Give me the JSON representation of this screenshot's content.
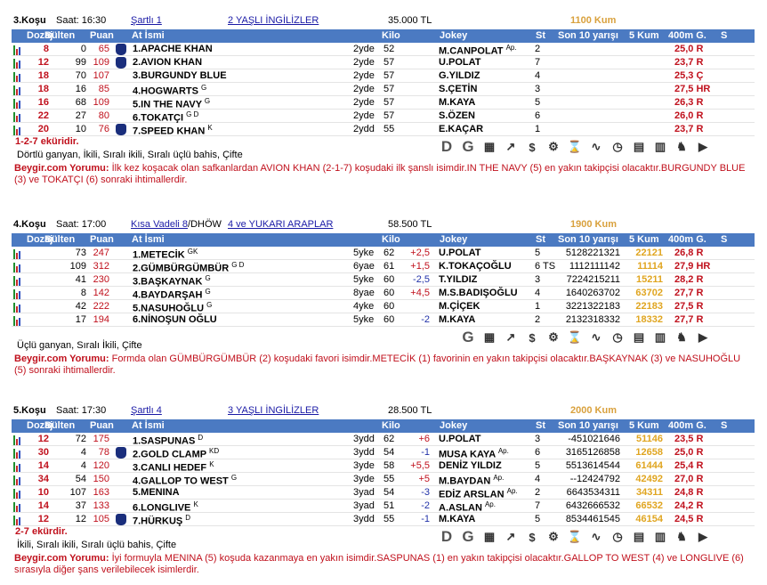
{
  "races": [
    {
      "kosu": "3.Koşu",
      "saat": "Saat: 16:30",
      "kosul": "Şartlı 1",
      "kosul2": "",
      "grup": "2 YAŞLI İNGİLİZLER",
      "ikramiye": "35.000 TL",
      "mesafe": "1100 Kum",
      "winners": "1-2-7 eküridir.",
      "bets": "Dörtlü ganyan, İkili, Sıralı ikili, Sıralı üçlü bahis, Çifte",
      "comment_label": "Beygir.com Yorumu:",
      "comment": "İlk kez koşacak olan safkanlardan AVION KHAN (2-1-7) koşudaki ilk şanslı isimdir.IN THE NAVY (5) en yakın takipçisi olacaktır.BURGUNDY BLUE (3) ve TOKATÇI (6) sonraki ihtimallerdir.",
      "toolbar": "full",
      "rows": [
        {
          "dozaj": "8",
          "bulten": "0",
          "puan": "65",
          "jokey_silk": true,
          "name": "1.APACHE KHAN",
          "sup": "",
          "age": "2yde",
          "kilo": "52",
          "plus": "",
          "jockey": "M.CANPOLAT",
          "jsup": "Ap.",
          "st": "2",
          "son": "",
          "k5": "",
          "g400": "25,0 R"
        },
        {
          "dozaj": "12",
          "bulten": "99",
          "puan": "109",
          "jokey_silk": true,
          "name": "2.AVION KHAN",
          "sup": "",
          "age": "2yde",
          "kilo": "57",
          "plus": "",
          "jockey": "U.POLAT",
          "jsup": "",
          "st": "7",
          "son": "",
          "k5": "",
          "g400": "23,7 R"
        },
        {
          "dozaj": "18",
          "bulten": "70",
          "puan": "107",
          "jokey_silk": false,
          "name": "3.BURGUNDY BLUE",
          "sup": "",
          "age": "2yde",
          "kilo": "57",
          "plus": "",
          "jockey": "G.YILDIZ",
          "jsup": "",
          "st": "4",
          "son": "",
          "k5": "",
          "g400": "25,3 Ç"
        },
        {
          "dozaj": "18",
          "bulten": "16",
          "puan": "85",
          "jokey_silk": false,
          "name": "4.HOGWARTS",
          "sup": "G",
          "age": "2yde",
          "kilo": "57",
          "plus": "",
          "jockey": "S.ÇETİN",
          "jsup": "",
          "st": "3",
          "son": "",
          "k5": "",
          "g400": "27,5 HR"
        },
        {
          "dozaj": "16",
          "bulten": "68",
          "puan": "109",
          "jokey_silk": false,
          "name": "5.IN THE NAVY",
          "sup": "G",
          "age": "2yde",
          "kilo": "57",
          "plus": "",
          "jockey": "M.KAYA",
          "jsup": "",
          "st": "5",
          "son": "",
          "k5": "",
          "g400": "26,3 R"
        },
        {
          "dozaj": "22",
          "bulten": "27",
          "puan": "80",
          "jokey_silk": false,
          "name": "6.TOKATÇI",
          "sup": "G D",
          "age": "2yde",
          "kilo": "57",
          "plus": "",
          "jockey": "S.ÖZEN",
          "jsup": "",
          "st": "6",
          "son": "",
          "k5": "",
          "g400": "26,0 R"
        },
        {
          "dozaj": "20",
          "bulten": "10",
          "puan": "76",
          "jokey_silk": true,
          "name": "7.SPEED KHAN",
          "sup": "K",
          "age": "2ydd",
          "kilo": "55",
          "plus": "",
          "jockey": "E.KAÇAR",
          "jsup": "",
          "st": "1",
          "son": "",
          "k5": "",
          "g400": "23,7 R"
        }
      ]
    },
    {
      "kosu": "4.Koşu",
      "saat": "Saat: 17:00",
      "kosul": "Kısa Vadeli 8",
      "kosul2": "/DHÖW",
      "grup": "4 ve YUKARI ARAPLAR",
      "ikramiye": "58.500 TL",
      "mesafe": "1900 Kum",
      "winners": "",
      "bets": "Üçlü ganyan, Sıralı İkili, Çifte",
      "comment_label": "Beygir.com Yorumu:",
      "comment": "Formda olan GÜMBÜRGÜMBÜR (2) koşudaki favori isimdir.METECİK (1) favorinin en yakın takipçisi olacaktır.BAŞKAYNAK (3) ve NASUHOĞLU (5) sonraki ihtimallerdir.",
      "toolbar": "short",
      "rows": [
        {
          "dozaj": "",
          "bulten": "73",
          "puan": "247",
          "jokey_silk": false,
          "name": "1.METECİK",
          "sup": "GK",
          "age": "5yke",
          "kilo": "62",
          "plus": "+2,5",
          "jockey": "U.POLAT",
          "jsup": "",
          "st": "5",
          "son": "5128221321",
          "k5": "22121",
          "g400": "26,8 R"
        },
        {
          "dozaj": "",
          "bulten": "109",
          "puan": "312",
          "jokey_silk": false,
          "name": "2.GÜMBÜRGÜMBÜR",
          "sup": "G D",
          "age": "6yae",
          "kilo": "61",
          "plus": "+1,5",
          "jockey": "K.TOKAÇOĞLU",
          "jsup": "",
          "st": "6 TS",
          "son": "1112111142",
          "k5": "11114",
          "g400": "27,9 HR"
        },
        {
          "dozaj": "",
          "bulten": "41",
          "puan": "230",
          "jokey_silk": false,
          "name": "3.BAŞKAYNAK",
          "sup": "G",
          "age": "5yke",
          "kilo": "60",
          "plus": "-2,5",
          "jockey": "T.YILDIZ",
          "jsup": "",
          "st": "3",
          "son": "7224215211",
          "k5": "15211",
          "g400": "28,2 R"
        },
        {
          "dozaj": "",
          "bulten": "8",
          "puan": "142",
          "jokey_silk": false,
          "name": "4.BAYDARŞAH",
          "sup": "G",
          "age": "8yae",
          "kilo": "60",
          "plus": "+4,5",
          "jockey": "M.S.BADIŞOĞLU",
          "jsup": "",
          "st": "4",
          "son": "1640263702",
          "k5": "63702",
          "g400": "27,7 R"
        },
        {
          "dozaj": "",
          "bulten": "42",
          "puan": "222",
          "jokey_silk": false,
          "name": "5.NASUHOĞLU",
          "sup": "G",
          "age": "4yke",
          "kilo": "60",
          "plus": "",
          "jockey": "M.ÇİÇEK",
          "jsup": "",
          "st": "1",
          "son": "3221322183",
          "k5": "22183",
          "g400": "27,5 R"
        },
        {
          "dozaj": "",
          "bulten": "17",
          "puan": "194",
          "jokey_silk": false,
          "name": "6.NİNOŞUN OĞLU",
          "sup": "",
          "age": "5yke",
          "kilo": "60",
          "plus": "-2",
          "jockey": "M.KAYA",
          "jsup": "",
          "st": "2",
          "son": "2132318332",
          "k5": "18332",
          "g400": "27,7 R"
        }
      ]
    },
    {
      "kosu": "5.Koşu",
      "saat": "Saat: 17:30",
      "kosul": "Şartlı 4",
      "kosul2": "",
      "grup": "3 YAŞLI İNGİLİZLER",
      "ikramiye": "28.500 TL",
      "mesafe": "2000 Kum",
      "winners": "2-7 ekürdir.",
      "bets": "İkili, Sıralı ikili, Sıralı üçlü bahis, Çifte",
      "comment_label": "Beygir.com Yorumu:",
      "comment": "İyi formuyla MENINA (5) koşuda kazanmaya en yakın isimdir.SASPUNAS (1) en yakın takipçisi olacaktır.GALLOP TO WEST (4) ve LONGLIVE (6) sırasıyla diğer şans verilebilecek isimlerdir.",
      "toolbar": "full",
      "rows": [
        {
          "dozaj": "12",
          "bulten": "72",
          "puan": "175",
          "jokey_silk": false,
          "name": "1.SASPUNAS",
          "sup": "D",
          "age": "3ydd",
          "kilo": "62",
          "plus": "+6",
          "jockey": "U.POLAT",
          "jsup": "",
          "st": "3",
          "son": "-451021646",
          "k5": "51146",
          "g400": "23,5 R"
        },
        {
          "dozaj": "30",
          "bulten": "4",
          "puan": "78",
          "jokey_silk": true,
          "name": "2.GOLD CLAMP",
          "sup": "KD",
          "age": "3ydd",
          "kilo": "54",
          "plus": "-1",
          "jockey": "MUSA KAYA",
          "jsup": "Ap.",
          "st": "6",
          "son": "3165126858",
          "k5": "12658",
          "g400": "25,0 R"
        },
        {
          "dozaj": "14",
          "bulten": "4",
          "puan": "120",
          "jokey_silk": false,
          "name": "3.CANLI HEDEF",
          "sup": "K",
          "age": "3yde",
          "kilo": "58",
          "plus": "+5,5",
          "jockey": "DENİZ YILDIZ",
          "jsup": "",
          "st": "5",
          "son": "5513614544",
          "k5": "61444",
          "g400": "25,4 R"
        },
        {
          "dozaj": "34",
          "bulten": "54",
          "puan": "150",
          "jokey_silk": false,
          "name": "4.GALLOP TO WEST",
          "sup": "G",
          "age": "3yde",
          "kilo": "55",
          "plus": "+5",
          "jockey": "M.BAYDAN",
          "jsup": "Ap.",
          "st": "4",
          "son": "--12424792",
          "k5": "42492",
          "g400": "27,0 R"
        },
        {
          "dozaj": "10",
          "bulten": "107",
          "puan": "163",
          "jokey_silk": false,
          "name": "5.MENINA",
          "sup": "",
          "age": "3yad",
          "kilo": "54",
          "plus": "-3",
          "jockey": "EDİZ ARSLAN",
          "jsup": "Ap.",
          "st": "2",
          "son": "6643534311",
          "k5": "34311",
          "g400": "24,8 R"
        },
        {
          "dozaj": "14",
          "bulten": "37",
          "puan": "133",
          "jokey_silk": false,
          "name": "6.LONGLIVE",
          "sup": "K",
          "age": "3yad",
          "kilo": "51",
          "plus": "-2",
          "jockey": "A.ASLAN",
          "jsup": "Ap.",
          "st": "7",
          "son": "6432666532",
          "k5": "66532",
          "g400": "24,2 R"
        },
        {
          "dozaj": "12",
          "bulten": "12",
          "puan": "105",
          "jokey_silk": true,
          "name": "7.HÜRKUŞ",
          "sup": "D",
          "age": "3ydd",
          "kilo": "55",
          "plus": "-1",
          "jockey": "M.KAYA",
          "jsup": "",
          "st": "5",
          "son": "8534461545",
          "k5": "46154",
          "g400": "24,5 R"
        }
      ]
    }
  ],
  "columns": {
    "dozaj": "Dozaj",
    "bulten": "Bülten",
    "puan": "Puan",
    "name": "At İsmi",
    "kilo": "Kilo",
    "jokey": "Jokey",
    "st": "St",
    "son10": "Son 10 yarışı",
    "k5": "5 Kum",
    "g400": "400m G.",
    "s": "S"
  },
  "toolbar_full": [
    "D",
    "G",
    "stats-icon",
    "trend-icon",
    "dollar-icon",
    "gear-icon",
    "hourglass-icon",
    "chart-icon",
    "stopwatch-icon",
    "calculator-icon",
    "grid-icon",
    "horse-icon",
    "video-icon"
  ],
  "toolbar_short": [
    "G",
    "stats-icon",
    "trend-icon",
    "dollar-icon",
    "gear-icon",
    "hourglass-icon",
    "chart-icon",
    "stopwatch-icon",
    "calculator-icon",
    "grid-icon",
    "horse-icon",
    "video-icon"
  ],
  "toolbar_glyphs": {
    "stats-icon": "▦",
    "trend-icon": "↗",
    "dollar-icon": "$",
    "gear-icon": "⚙",
    "hourglass-icon": "⌛",
    "chart-icon": "∿",
    "stopwatch-icon": "◷",
    "calculator-icon": "▤",
    "grid-icon": "▥",
    "horse-icon": "♞",
    "video-icon": "▶"
  },
  "colors": {
    "header_bg": "#4b7ac2",
    "red": "#c0101c",
    "gold": "#d9a13d",
    "link": "#1a1aa6"
  }
}
